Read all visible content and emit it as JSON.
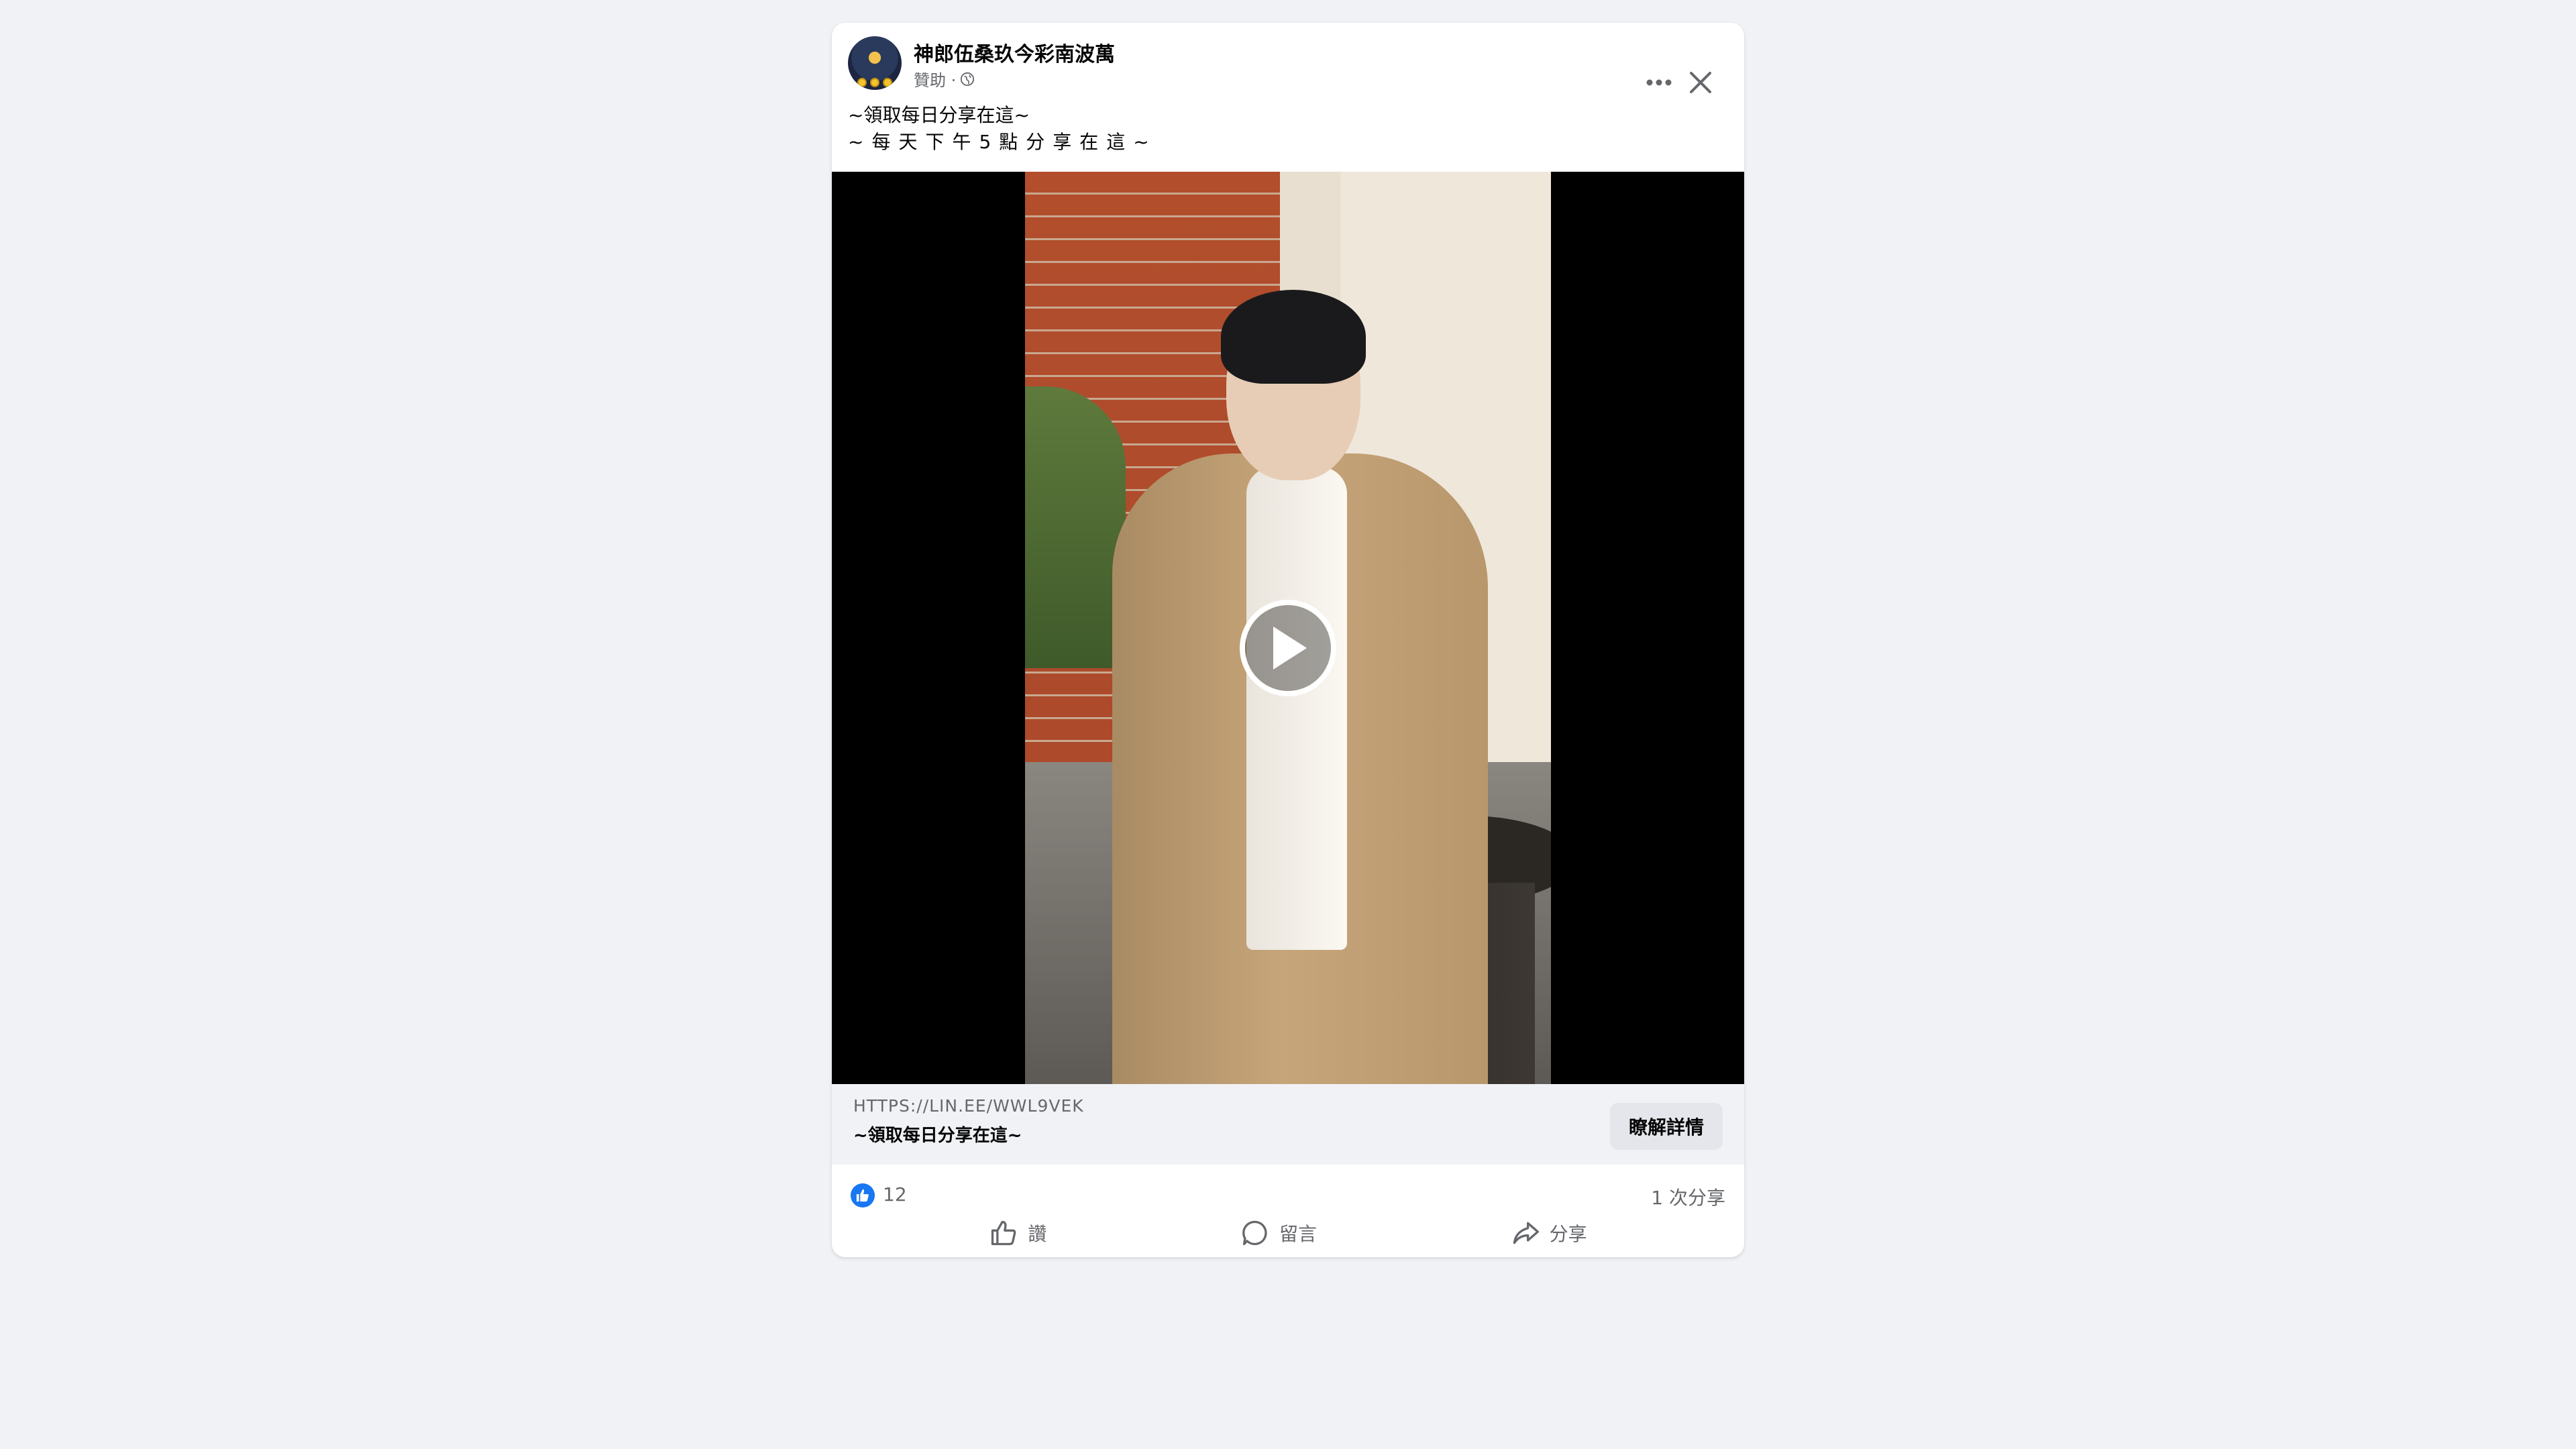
{
  "post": {
    "page_name": "神郎伍桑玖今彩南波萬",
    "sponsored_label": "贊助 ·",
    "text_line1": "~領取每日分享在這~",
    "text_line2": "~每天下午5點分享在這~"
  },
  "link": {
    "domain": "HTTPS://LIN.EE/WWL9VEK",
    "title": "~領取每日分享在這~",
    "cta_label": "瞭解詳情"
  },
  "stats": {
    "likes": "12",
    "shares": "1 次分享"
  },
  "actions": {
    "like_label": "讚",
    "comment_label": "留言",
    "share_label": "分享"
  },
  "icons": {
    "more": "more-icon",
    "close": "close-icon",
    "globe": "globe-icon",
    "play": "play-icon",
    "like": "thumbs-up-icon",
    "comment": "comment-icon",
    "share": "share-icon"
  },
  "colors": {
    "accent": "#1877f2",
    "background": "#f0f2f5",
    "secondary_text": "#65676b"
  }
}
